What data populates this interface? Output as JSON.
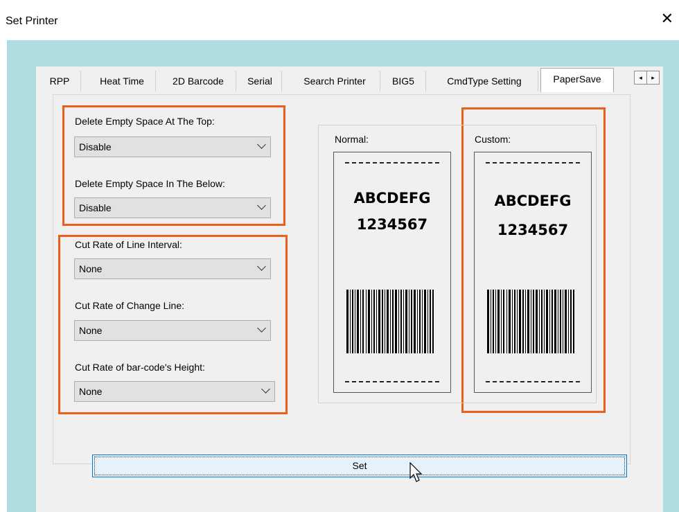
{
  "window": {
    "title": "Set Printer",
    "close_label": "✕"
  },
  "tabs": [
    {
      "label": "RPP",
      "active": false
    },
    {
      "label": "Heat Time",
      "active": false
    },
    {
      "label": "2D Barcode",
      "active": false
    },
    {
      "label": "Serial",
      "active": false
    },
    {
      "label": "Search Printer",
      "active": false
    },
    {
      "label": "BIG5",
      "active": false
    },
    {
      "label": "CmdType Setting",
      "active": false
    },
    {
      "label": "PaperSave",
      "active": true
    }
  ],
  "tab_scroll": {
    "left_icon": "◂",
    "right_icon": "▸"
  },
  "fields": {
    "top_space": {
      "label": "Delete Empty Space At The Top:",
      "value": "Disable"
    },
    "below_space": {
      "label": "Delete Empty Space In The Below:",
      "value": "Disable"
    },
    "line_interval": {
      "label": "Cut Rate of Line Interval:",
      "value": "None"
    },
    "change_line": {
      "label": "Cut Rate of Change Line:",
      "value": "None"
    },
    "barcode_height": {
      "label": "Cut Rate of bar-code's Height:",
      "value": "None"
    }
  },
  "preview": {
    "normal": {
      "label": "Normal:",
      "line1": "ABCDEFG",
      "line2": "1234567"
    },
    "custom": {
      "label": "Custom:",
      "line1": "ABCDEFG",
      "line2": "1234567"
    }
  },
  "set_button": {
    "label": "Set"
  },
  "colors": {
    "highlight": "#e8601c",
    "accent": "#0078d7",
    "background": "#b0dde0"
  }
}
